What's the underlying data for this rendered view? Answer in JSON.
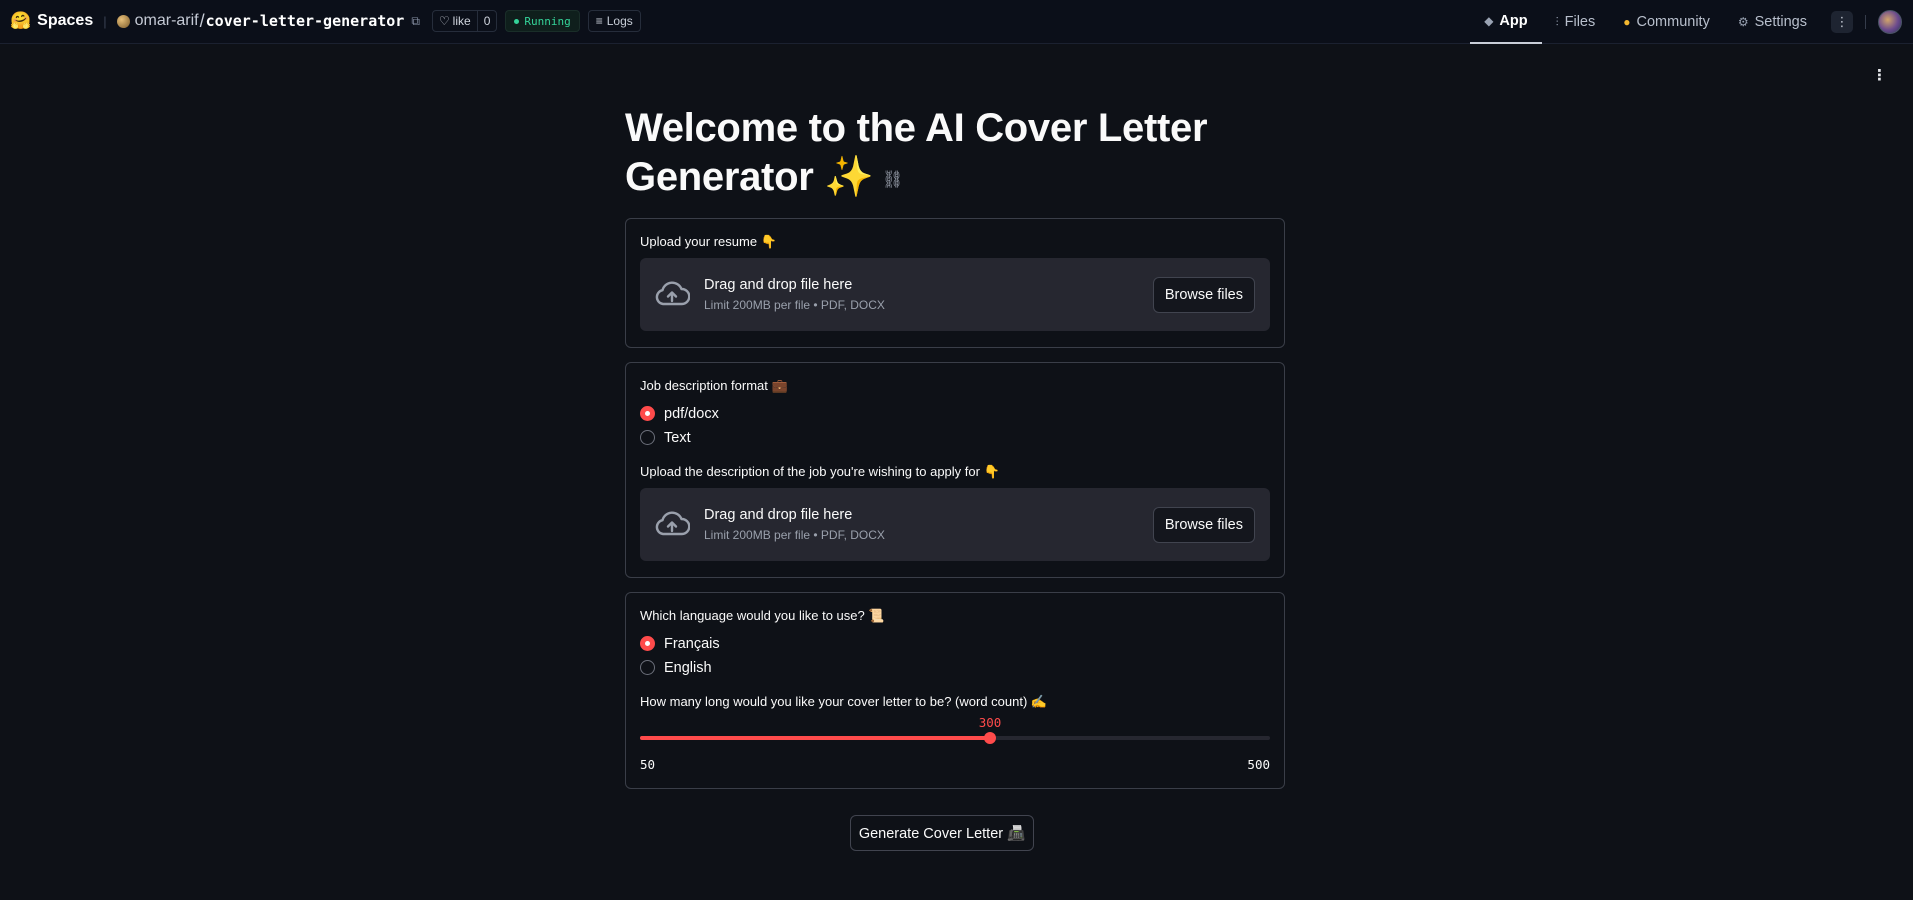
{
  "nav": {
    "logo_emoji": "🤗",
    "brand": "Spaces",
    "owner": "omar-arif",
    "slash": "/",
    "repo": "cover-letter-generator",
    "like_label": "like",
    "like_count": "0",
    "status": "Running",
    "logs_label": "Logs",
    "tabs": [
      {
        "label": "App",
        "icon": "cube-icon",
        "active": true
      },
      {
        "label": "Files",
        "icon": "files-icon",
        "active": false
      },
      {
        "label": "Community",
        "icon": "community-icon",
        "active": false
      },
      {
        "label": "Settings",
        "icon": "gear-icon",
        "active": false
      }
    ]
  },
  "app": {
    "title": "Welcome to the AI Cover Letter Generator ✨",
    "resume": {
      "label": "Upload your resume 👇",
      "drop_text": "Drag and drop file here",
      "limit_text": "Limit 200MB per file • PDF, DOCX",
      "browse_label": "Browse files"
    },
    "job": {
      "format_label": "Job description format 💼",
      "format_options": [
        "pdf/docx",
        "Text"
      ],
      "format_selected": "pdf/docx",
      "upload_label": "Upload the description of the job you're wishing to apply for 👇",
      "drop_text": "Drag and drop file here",
      "limit_text": "Limit 200MB per file • PDF, DOCX",
      "browse_label": "Browse files"
    },
    "language": {
      "label": "Which language would you like to use? 📜",
      "options": [
        "Français",
        "English"
      ],
      "selected": "Français"
    },
    "length": {
      "label": "How many long would you like your cover letter to be? (word count) ✍️",
      "min": 50,
      "max": 500,
      "value": 300,
      "min_label": "50",
      "max_label": "500",
      "value_label": "300"
    },
    "generate_label": "Generate Cover Letter 📠"
  },
  "colors": {
    "accent": "#ff4b4b",
    "running": "#34d399",
    "background": "#0e1117"
  }
}
